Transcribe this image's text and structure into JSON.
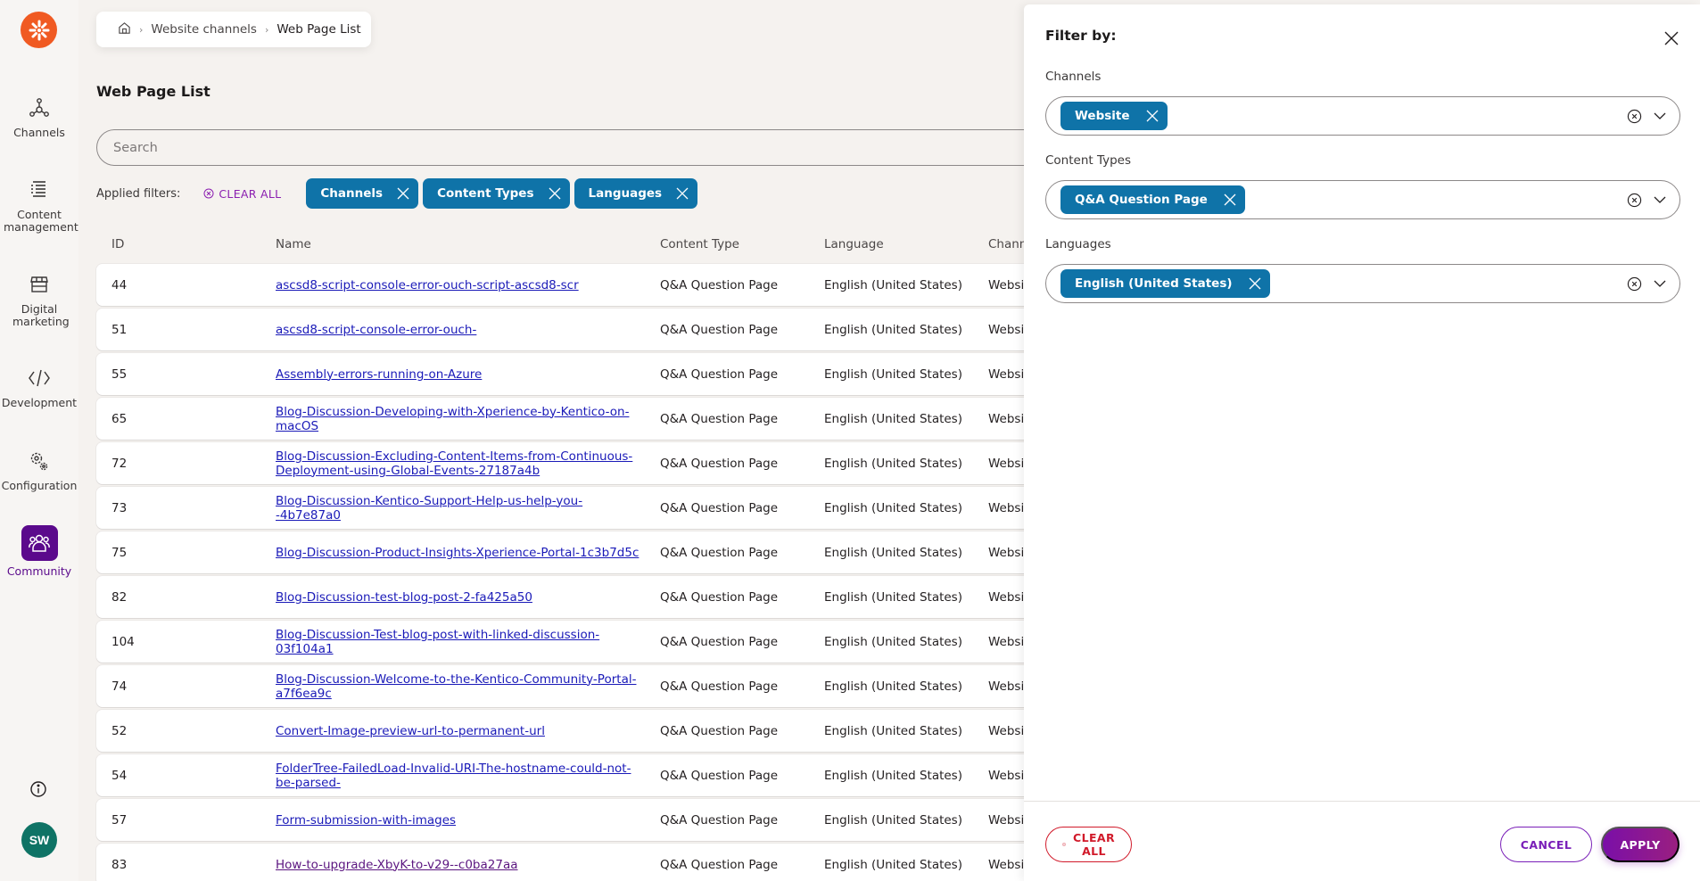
{
  "sidebar": {
    "logo": "kentico-logo",
    "items": [
      {
        "label": "Channels",
        "icon": "channels-icon"
      },
      {
        "label": "Content management",
        "icon": "content-management-icon"
      },
      {
        "label": "Digital marketing",
        "icon": "digital-marketing-icon"
      },
      {
        "label": "Development",
        "icon": "development-icon"
      },
      {
        "label": "Configuration",
        "icon": "configuration-icon"
      },
      {
        "label": "Community",
        "icon": "community-icon",
        "active": true
      }
    ],
    "info_icon": "info-icon",
    "avatar_initials": "SW"
  },
  "breadcrumb": {
    "home_icon": "home-icon",
    "items": [
      "Website channels",
      "Web Page List"
    ]
  },
  "page_title": "Web Page List",
  "search": {
    "placeholder": "Search",
    "value": ""
  },
  "applied_filters": {
    "label": "Applied filters:",
    "clear_all": "CLEAR ALL",
    "chips": [
      "Channels",
      "Content Types",
      "Languages"
    ]
  },
  "table": {
    "columns": [
      "ID",
      "Name",
      "Content Type",
      "Language",
      "Chann"
    ],
    "rows": [
      {
        "id": "44",
        "name": "ascsd8-script-console-error-ouch-script-ascsd8-scr",
        "type": "Q&A Question Page",
        "language": "English (United States)",
        "channel": "Websi"
      },
      {
        "id": "51",
        "name": "ascsd8-script-console-error-ouch-",
        "type": "Q&A Question Page",
        "language": "English (United States)",
        "channel": "Websi"
      },
      {
        "id": "55",
        "name": "Assembly-errors-running-on-Azure",
        "type": "Q&A Question Page",
        "language": "English (United States)",
        "channel": "Websi"
      },
      {
        "id": "65",
        "name": "Blog-Discussion-Developing-with-Xperience-by-Kentico-on-macOS",
        "type": "Q&A Question Page",
        "language": "English (United States)",
        "channel": "Websi"
      },
      {
        "id": "72",
        "name": "Blog-Discussion-Excluding-Content-Items-from-Continuous-Deployment-using-Global-Events-27187a4b",
        "type": "Q&A Question Page",
        "language": "English (United States)",
        "channel": "Websi"
      },
      {
        "id": "73",
        "name": "Blog-Discussion-Kentico-Support-Help-us-help-you--4b7e87a0",
        "type": "Q&A Question Page",
        "language": "English (United States)",
        "channel": "Websi"
      },
      {
        "id": "75",
        "name": "Blog-Discussion-Product-Insights-Xperience-Portal-1c3b7d5c",
        "type": "Q&A Question Page",
        "language": "English (United States)",
        "channel": "Websi"
      },
      {
        "id": "82",
        "name": "Blog-Discussion-test-blog-post-2-fa425a50",
        "type": "Q&A Question Page",
        "language": "English (United States)",
        "channel": "Websi"
      },
      {
        "id": "104",
        "name": "Blog-Discussion-Test-blog-post-with-linked-discussion-03f104a1",
        "type": "Q&A Question Page",
        "language": "English (United States)",
        "channel": "Websi"
      },
      {
        "id": "74",
        "name": "Blog-Discussion-Welcome-to-the-Kentico-Community-Portal-a7f6ea9c",
        "type": "Q&A Question Page",
        "language": "English (United States)",
        "channel": "Websi"
      },
      {
        "id": "52",
        "name": "Convert-Image-preview-url-to-permanent-url",
        "type": "Q&A Question Page",
        "language": "English (United States)",
        "channel": "Websi"
      },
      {
        "id": "54",
        "name": "FolderTree-FailedLoad-Invalid-URI-The-hostname-could-not-be-parsed-",
        "type": "Q&A Question Page",
        "language": "English (United States)",
        "channel": "Websi"
      },
      {
        "id": "57",
        "name": "Form-submission-with-images",
        "type": "Q&A Question Page",
        "language": "English (United States)",
        "channel": "Websi"
      },
      {
        "id": "83",
        "name": "How-to-upgrade-XbyK-to-v29--c0ba27aa",
        "type": "Q&A Question Page",
        "language": "English (United States)",
        "channel": "Websi",
        "visited": true
      }
    ]
  },
  "filter_panel": {
    "title": "Filter by:",
    "groups": [
      {
        "label": "Channels",
        "selected": [
          "Website"
        ]
      },
      {
        "label": "Content Types",
        "selected": [
          "Q&A Question Page"
        ]
      },
      {
        "label": "Languages",
        "selected": [
          "English (United States)"
        ]
      }
    ],
    "footer": {
      "clear_all": "CLEAR ALL",
      "cancel": "CANCEL",
      "apply": "APPLY"
    }
  },
  "colors": {
    "brand_orange": "#f05a22",
    "chip_blue": "#0f73a8",
    "active_purple": "#5b0a8c",
    "danger_red": "#d11a2a",
    "avatar_teal": "#0f7365",
    "link_blue": "#1a1ab8"
  }
}
